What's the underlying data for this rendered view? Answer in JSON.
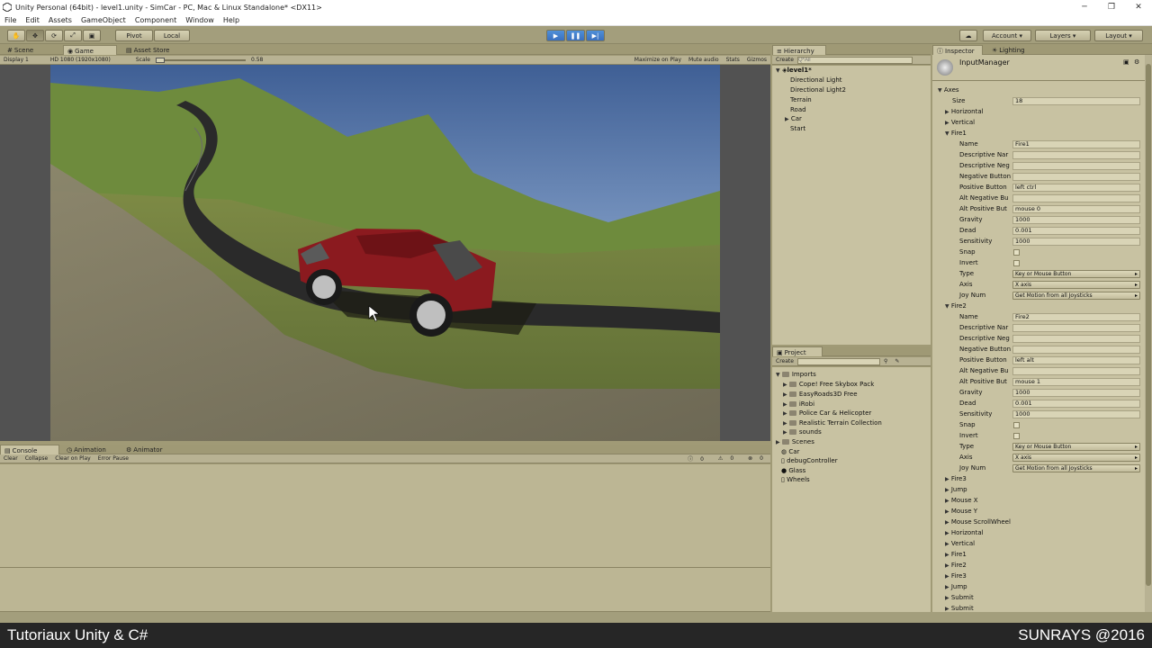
{
  "window": {
    "title": "Unity Personal (64bit) - level1.unity - SimCar - PC, Mac & Linux Standalone* <DX11>",
    "controls": {
      "minimize": "─",
      "maximize": "❐",
      "close": "✕"
    }
  },
  "menu": [
    "File",
    "Edit",
    "Assets",
    "GameObject",
    "Component",
    "Window",
    "Help"
  ],
  "toolbar": {
    "pivot": "Pivot",
    "local": "Local",
    "account": "Account",
    "layers": "Layers",
    "layout": "Layout"
  },
  "scene_tabs": {
    "scene": "Scene",
    "game": "Game",
    "asset_store": "Asset Store"
  },
  "game_bar": {
    "display": "Display 1",
    "resolution": "HD 1080 (1920x1080)",
    "scale_label": "Scale",
    "scale_value": "0.58",
    "maximize": "Maximize on Play",
    "mute": "Mute audio",
    "stats": "Stats",
    "gizmos": "Gizmos"
  },
  "console_tabs": {
    "console": "Console",
    "animation": "Animation",
    "animator": "Animator"
  },
  "console_bar": {
    "clear": "Clear",
    "collapse": "Collapse",
    "clear_on_play": "Clear on Play",
    "error_pause": "Error Pause",
    "counts": [
      "0",
      "0",
      "0"
    ]
  },
  "hierarchy": {
    "tab": "Hierarchy",
    "create": "Create",
    "search_placeholder": "Q*All",
    "scene": "level1*",
    "items": [
      "Directional Light",
      "Directional Light2",
      "Terrain",
      "Road",
      "Car",
      "Start"
    ]
  },
  "project": {
    "tab": "Project",
    "create": "Create",
    "root": "Imports",
    "folders": [
      "Cope! Free Skybox Pack",
      "EasyRoads3D Free",
      "iRobi",
      "Police Car & Helicopter",
      "Realistic Terrain Collection",
      "sounds"
    ],
    "scenes": "Scenes",
    "assets": [
      "Car",
      "debugController",
      "Glass",
      "Wheels"
    ]
  },
  "inspector": {
    "tab": "Inspector",
    "lighting_tab": "Lighting",
    "object": "InputManager",
    "axes_label": "Axes",
    "size_label": "Size",
    "size_value": "18",
    "collapsed_top": [
      "Horizontal",
      "Vertical"
    ],
    "fire1": {
      "label": "Fire1",
      "rows": [
        {
          "k": "Name",
          "v": "Fire1"
        },
        {
          "k": "Descriptive Nar",
          "v": ""
        },
        {
          "k": "Descriptive Neg",
          "v": ""
        },
        {
          "k": "Negative Button",
          "v": ""
        },
        {
          "k": "Positive Button",
          "v": "left ctrl"
        },
        {
          "k": "Alt Negative Bu",
          "v": ""
        },
        {
          "k": "Alt Positive But",
          "v": "mouse 0"
        },
        {
          "k": "Gravity",
          "v": "1000"
        },
        {
          "k": "Dead",
          "v": "0.001"
        },
        {
          "k": "Sensitivity",
          "v": "1000"
        }
      ],
      "snap": "Snap",
      "invert": "Invert",
      "type_label": "Type",
      "type_value": "Key or Mouse Button",
      "axis_label": "Axis",
      "axis_value": "X axis",
      "joy_label": "Joy Num",
      "joy_value": "Get Motion from all Joysticks"
    },
    "fire2": {
      "label": "Fire2",
      "rows": [
        {
          "k": "Name",
          "v": "Fire2"
        },
        {
          "k": "Descriptive Nar",
          "v": ""
        },
        {
          "k": "Descriptive Neg",
          "v": ""
        },
        {
          "k": "Negative Button",
          "v": ""
        },
        {
          "k": "Positive Button",
          "v": "left alt"
        },
        {
          "k": "Alt Negative Bu",
          "v": ""
        },
        {
          "k": "Alt Positive But",
          "v": "mouse 1"
        },
        {
          "k": "Gravity",
          "v": "1000"
        },
        {
          "k": "Dead",
          "v": "0.001"
        },
        {
          "k": "Sensitivity",
          "v": "1000"
        }
      ],
      "snap": "Snap",
      "invert": "Invert",
      "type_label": "Type",
      "type_value": "Key or Mouse Button",
      "axis_label": "Axis",
      "axis_value": "X axis",
      "joy_label": "Joy Num",
      "joy_value": "Get Motion from all Joysticks"
    },
    "collapsed_bottom": [
      "Fire3",
      "Jump",
      "Mouse X",
      "Mouse Y",
      "Mouse ScrollWheel",
      "Horizontal",
      "Vertical",
      "Fire1",
      "Fire2",
      "Fire3",
      "Jump",
      "Submit",
      "Submit"
    ]
  },
  "caption": {
    "left": "Tutoriaux Unity & C#",
    "right": "SUNRAYS @2016"
  },
  "colors": {
    "editor_bg": "#c8c2a2",
    "play_blue": "#3a70bf",
    "car_red": "#8b1a1f"
  }
}
